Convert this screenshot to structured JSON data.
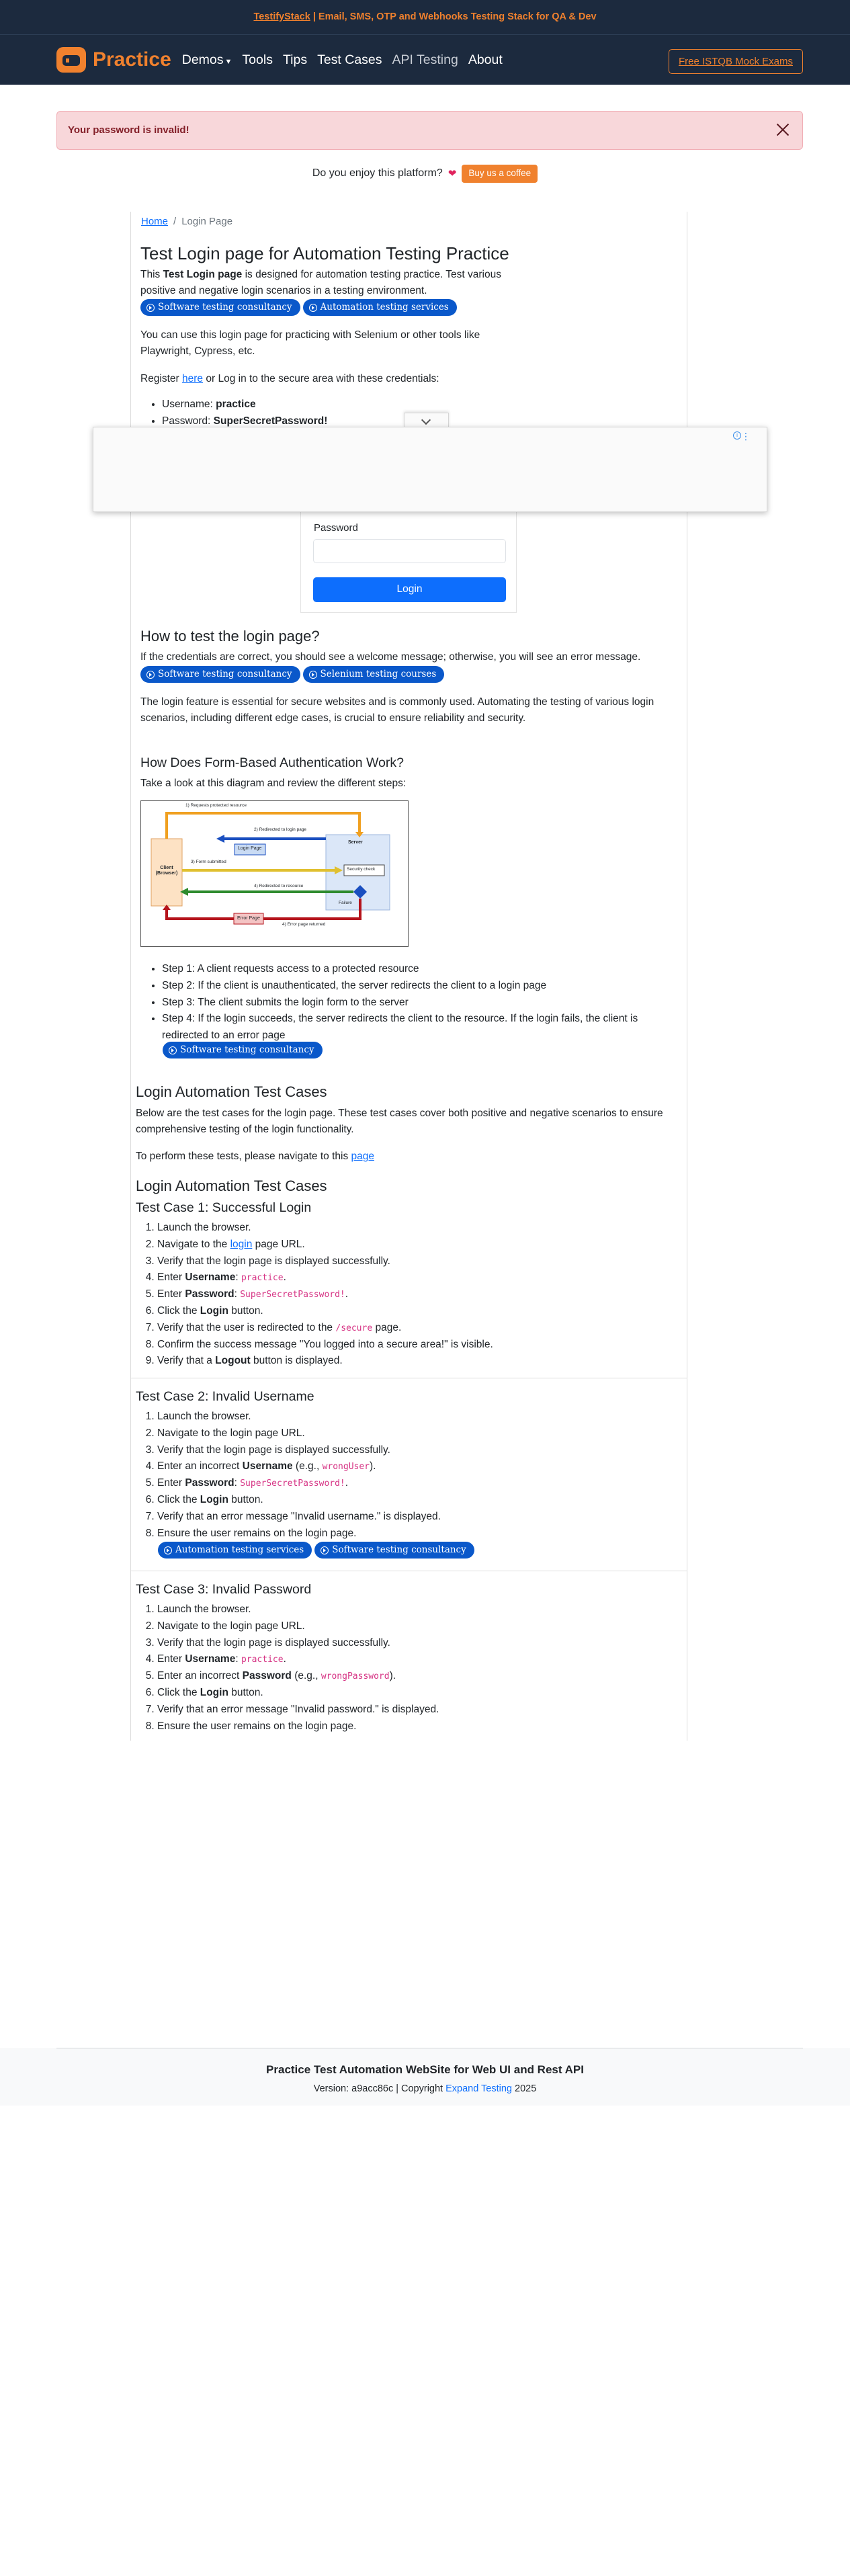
{
  "topbar": {
    "link": "TestifyStack",
    "text": " | Email, SMS, OTP and Webhooks Testing Stack for QA & Dev"
  },
  "nav": {
    "brand": "Practice",
    "items": [
      "Demos",
      "Tools",
      "Tips",
      "Test Cases",
      "API Testing",
      "About"
    ],
    "cta": "Free ISTQB Mock Exams"
  },
  "alert": {
    "message": "Your password is invalid!"
  },
  "coffee": {
    "text": "Do you enjoy this platform?",
    "button": "Buy us a coffee"
  },
  "breadcrumb": {
    "home": "Home",
    "sep": "/",
    "current": "Login Page"
  },
  "intro": {
    "title": "Test Login page for Automation Testing Practice",
    "p1_pre": "This ",
    "p1_bold": "Test Login page",
    "p1_post": " is designed for automation testing practice. Test various positive and negative login scenarios in a testing environment.",
    "pills": [
      "Software testing consultancy",
      "Automation testing services"
    ],
    "p2": "You can use this login page for practicing with Selenium or other tools like Playwright, Cypress, etc.",
    "p3_pre": "Register ",
    "p3_link": "here",
    "p3_post": " or Log in to the secure area with these credentials:",
    "cred_user_label": "Username: ",
    "cred_user": "practice",
    "cred_pass_label": "Password: ",
    "cred_pass": "SuperSecretPassword!"
  },
  "login_form": {
    "password_label": "Password",
    "password_value": "",
    "button": "Login"
  },
  "how_to": {
    "title": "How to test the login page?",
    "p1": "If the credentials are correct, you should see a welcome message; otherwise, you will see an error message.",
    "pills": [
      "Software testing consultancy",
      "Selenium testing courses"
    ],
    "p2": "The login feature is essential for secure websites and is commonly used. Automating the testing of various login scenarios, including different edge cases, is crucial to ensure reliability and security."
  },
  "form_auth": {
    "title": "How Does Form-Based Authentication Work?",
    "intro": "Take a look at this diagram and review the different steps:",
    "diagram": {
      "client": "Client (Browser)",
      "server": "Server",
      "login_page": "Login Page",
      "security_check": "Security check",
      "failure": "Failure",
      "error_page": "Error Page",
      "arrows": [
        "1) Requests protected resource",
        "2) Redirected to login page",
        "3) Form submitted",
        "4) Redirected to resource",
        "4) Error page returned"
      ]
    },
    "steps": [
      "Step 1: A client requests access to a protected resource",
      "Step 2: If the client is unauthenticated, the server redirects the client to a login page",
      "Step 3: The client submits the login form to the server",
      "Step 4: If the login succeeds, the server redirects the client to the resource. If the login fails, the client is redirected to an error page"
    ],
    "pill": "Software testing consultancy"
  },
  "tests_intro": {
    "title": "Login Automation Test Cases",
    "p1": "Below are the test cases for the login page. These test cases cover both positive and negative scenarios to ensure comprehensive testing of the login functionality.",
    "p2_pre": "To perform these tests, please navigate to this ",
    "p2_link": "page"
  },
  "tests": {
    "title": "Login Automation Test Cases",
    "tc1": {
      "title": "Test Case 1: Successful Login",
      "s1": "Launch the browser.",
      "s2_pre": "Navigate to the ",
      "s2_link": "login",
      "s2_post": " page URL.",
      "s3": "Verify that the login page is displayed successfully.",
      "s4_pre": "Enter ",
      "s4_bold": "Username",
      "s4_mid": ": ",
      "s4_code": "practice",
      "s4_post": ".",
      "s5_pre": "Enter ",
      "s5_bold": "Password",
      "s5_mid": ": ",
      "s5_code": "SuperSecretPassword!",
      "s5_post": ".",
      "s6_pre": "Click the ",
      "s6_bold": "Login",
      "s6_post": " button.",
      "s7_pre": "Verify that the user is redirected to the ",
      "s7_code": "/secure",
      "s7_post": " page.",
      "s8": "Confirm the success message \"You logged into a secure area!\" is visible.",
      "s9_pre": "Verify that a ",
      "s9_bold": "Logout",
      "s9_post": " button is displayed."
    },
    "tc2": {
      "title": "Test Case 2: Invalid Username",
      "s1": "Launch the browser.",
      "s2": "Navigate to the login page URL.",
      "s3": "Verify that the login page is displayed successfully.",
      "s4_pre": "Enter an incorrect ",
      "s4_bold": "Username",
      "s4_mid": " (e.g., ",
      "s4_code": "wrongUser",
      "s4_post": ").",
      "s5_pre": "Enter ",
      "s5_bold": "Password",
      "s5_mid": ": ",
      "s5_code": "SuperSecretPassword!",
      "s5_post": ".",
      "s6_pre": "Click the ",
      "s6_bold": "Login",
      "s6_post": " button.",
      "s7": "Verify that an error message \"Invalid username.\" is displayed.",
      "s8": "Ensure the user remains on the login page.",
      "pills": [
        "Automation testing services",
        "Software testing consultancy"
      ]
    },
    "tc3": {
      "title": "Test Case 3: Invalid Password",
      "s1": "Launch the browser.",
      "s2": "Navigate to the login page URL.",
      "s3": "Verify that the login page is displayed successfully.",
      "s4_pre": "Enter ",
      "s4_bold": "Username",
      "s4_mid": ": ",
      "s4_code": "practice",
      "s4_post": ".",
      "s5_pre": "Enter an incorrect ",
      "s5_bold": "Password",
      "s5_mid": " (e.g., ",
      "s5_code": "wrongPassword",
      "s5_post": ").",
      "s6_pre": "Click the ",
      "s6_bold": "Login",
      "s6_post": " button.",
      "s7": "Verify that an error message \"Invalid password.\" is displayed.",
      "s8": "Ensure the user remains on the login page."
    }
  },
  "footer": {
    "title": "Practice Test Automation WebSite for Web UI and Rest API",
    "version_pre": "Version: a9acc86c | Copyright ",
    "version_link": "Expand Testing",
    "version_post": " 2025"
  }
}
